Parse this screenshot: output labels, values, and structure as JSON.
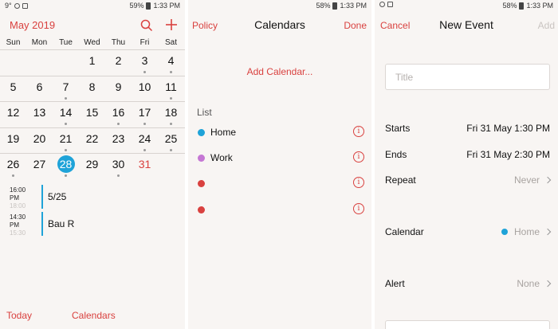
{
  "statusbar": {
    "left_text": "9°",
    "battery_1": "59%",
    "battery_2": "58%",
    "battery_3": "58%",
    "time": "1:33 PM"
  },
  "calendar_screen": {
    "month_title": "May 2019",
    "weekdays": [
      "Sun",
      "Mon",
      "Tue",
      "Wed",
      "Thu",
      "Fri",
      "Sat"
    ],
    "weeks": [
      [
        "",
        "",
        "",
        "1",
        "2",
        "3",
        "4"
      ],
      [
        "5",
        "6",
        "7",
        "8",
        "9",
        "10",
        "11"
      ],
      [
        "12",
        "13",
        "14",
        "15",
        "16",
        "17",
        "18"
      ],
      [
        "19",
        "20",
        "21",
        "22",
        "23",
        "24",
        "25"
      ],
      [
        "26",
        "27",
        "28",
        "29",
        "30",
        "31",
        ""
      ]
    ],
    "selected_day": "28",
    "agenda": [
      {
        "time": "16:00",
        "ampm": "PM",
        "end": "18:00",
        "title": "5/25"
      },
      {
        "time": "14:30",
        "ampm": "PM",
        "end": "15:30",
        "title": "Bau R"
      }
    ],
    "today_label": "Today",
    "calendars_label": "Calendars"
  },
  "calendars_screen": {
    "left": "Policy",
    "title": "Calendars",
    "right": "Done",
    "add_calendar": "Add Calendar...",
    "list_header": "List",
    "items": [
      {
        "name": "Home",
        "color": "#1fa3d8"
      },
      {
        "name": "Work",
        "color": "#c577d4"
      },
      {
        "name": "",
        "color": "#d9413f"
      },
      {
        "name": "",
        "color": "#d9413f"
      }
    ]
  },
  "new_event_screen": {
    "cancel": "Cancel",
    "title": "New Event",
    "add": "Add",
    "title_placeholder": "Title",
    "starts_label": "Starts",
    "starts_value": "Fri 31 May 1:30 PM",
    "ends_label": "Ends",
    "ends_value": "Fri 31 May 2:30 PM",
    "repeat_label": "Repeat",
    "repeat_value": "Never",
    "calendar_label": "Calendar",
    "calendar_value": "Home",
    "alert_label": "Alert",
    "alert_value": "None"
  },
  "colors": {
    "accent": "#d9413f",
    "selected": "#1fa3d8"
  }
}
